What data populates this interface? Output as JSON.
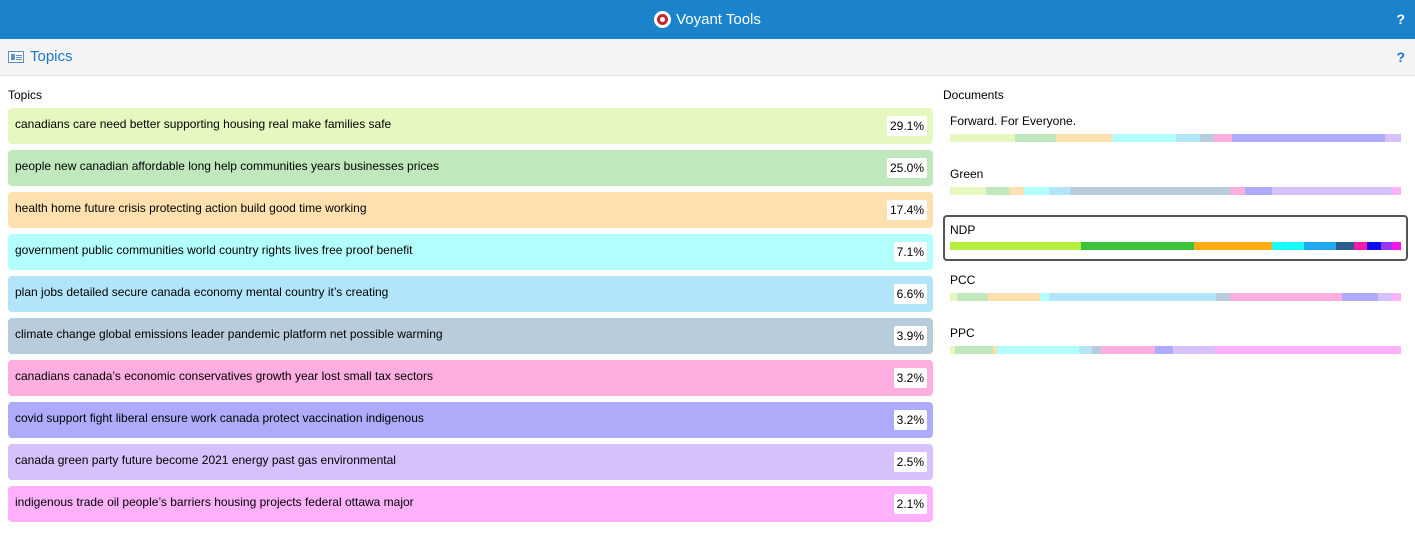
{
  "app": {
    "title": "Voyant Tools",
    "help": "?"
  },
  "panel": {
    "title": "Topics",
    "help": "?"
  },
  "topics_header": "Topics",
  "documents_header": "Documents",
  "topics": [
    {
      "words": "canadians care need better supporting housing real make families safe",
      "pct": "29.1%",
      "color": "#e6f8c0"
    },
    {
      "words": "people new canadian affordable long help communities years businesses prices",
      "pct": "25.0%",
      "color": "#bfe9bd"
    },
    {
      "words": "health home future crisis protecting action build good time working",
      "pct": "17.4%",
      "color": "#ffe1b0"
    },
    {
      "words": "government public communities world country rights lives free proof benefit",
      "pct": "7.1%",
      "color": "#b2fffd"
    },
    {
      "words": "plan jobs detailed secure canada economy mental country it’s creating",
      "pct": "6.6%",
      "color": "#b2e5fa"
    },
    {
      "words": "climate change global emissions leader pandemic platform net possible warming",
      "pct": "3.9%",
      "color": "#b9ccdb"
    },
    {
      "words": "canadians canada’s economic conservatives growth year lost small tax sectors",
      "pct": "3.2%",
      "color": "#ffaee0"
    },
    {
      "words": "covid support fight liberal ensure work canada protect vaccination indigenous",
      "pct": "3.2%",
      "color": "#aeacfa"
    },
    {
      "words": "canada green party future become 2021 energy past gas environmental",
      "pct": "2.5%",
      "color": "#d6c1fb"
    },
    {
      "words": "indigenous trade oil people’s barriers housing projects federal ottawa major",
      "pct": "2.1%",
      "color": "#ffb2fb"
    }
  ],
  "documents": [
    {
      "name": "Forward. For Everyone.",
      "selected": false,
      "segments": [
        [
          0.145,
          "#e6f8c0"
        ],
        [
          0.09,
          "#bfe9bd"
        ],
        [
          0.125,
          "#ffe1b0"
        ],
        [
          0.14,
          "#b2fffd"
        ],
        [
          0.055,
          "#b2e5fa"
        ],
        [
          0.03,
          "#b9ccdb"
        ],
        [
          0.04,
          "#ffaee0"
        ],
        [
          0.34,
          "#aeacfa"
        ],
        [
          0.035,
          "#d6c1fb"
        ]
      ]
    },
    {
      "name": "Green",
      "selected": false,
      "segments": [
        [
          0.08,
          "#e6f8c0"
        ],
        [
          0.05,
          "#bfe9bd"
        ],
        [
          0.035,
          "#ffe1b0"
        ],
        [
          0.055,
          "#b2fffd"
        ],
        [
          0.045,
          "#b2e5fa"
        ],
        [
          0.355,
          "#b9ccdb"
        ],
        [
          0.035,
          "#ffaee0"
        ],
        [
          0.06,
          "#aeacfa"
        ],
        [
          0.265,
          "#d6c1fb"
        ],
        [
          0.02,
          "#ffb2fb"
        ]
      ]
    },
    {
      "name": "NDP",
      "selected": true,
      "segments": [
        [
          0.29,
          "#b6ef3d"
        ],
        [
          0.25,
          "#39c43a"
        ],
        [
          0.175,
          "#ffad13"
        ],
        [
          0.07,
          "#18fdf8"
        ],
        [
          0.07,
          "#21a8f1"
        ],
        [
          0.04,
          "#2a5d8b"
        ],
        [
          0.03,
          "#ff1ba8"
        ],
        [
          0.03,
          "#0d0ef0"
        ],
        [
          0.025,
          "#9a35ef"
        ],
        [
          0.02,
          "#f816ec"
        ]
      ]
    },
    {
      "name": "PCC",
      "selected": false,
      "segments": [
        [
          0.015,
          "#e6f8c0"
        ],
        [
          0.07,
          "#bfe9bd"
        ],
        [
          0.115,
          "#ffe1b0"
        ],
        [
          0.02,
          "#b2fffd"
        ],
        [
          0.37,
          "#b2e5fa"
        ],
        [
          0.03,
          "#b9ccdb"
        ],
        [
          0.25,
          "#ffaee0"
        ],
        [
          0.08,
          "#aeacfa"
        ],
        [
          0.03,
          "#d6c1fb"
        ],
        [
          0.02,
          "#ffb2fb"
        ]
      ]
    },
    {
      "name": "PPC",
      "selected": false,
      "segments": [
        [
          0.01,
          "#e6f8c0"
        ],
        [
          0.085,
          "#bfe9bd"
        ],
        [
          0.01,
          "#ffe1b0"
        ],
        [
          0.18,
          "#b2fffd"
        ],
        [
          0.03,
          "#b2e5fa"
        ],
        [
          0.02,
          "#b9ccdb"
        ],
        [
          0.12,
          "#ffaee0"
        ],
        [
          0.04,
          "#aeacfa"
        ],
        [
          0.09,
          "#d6c1fb"
        ],
        [
          0.415,
          "#ffb2fb"
        ]
      ]
    }
  ]
}
